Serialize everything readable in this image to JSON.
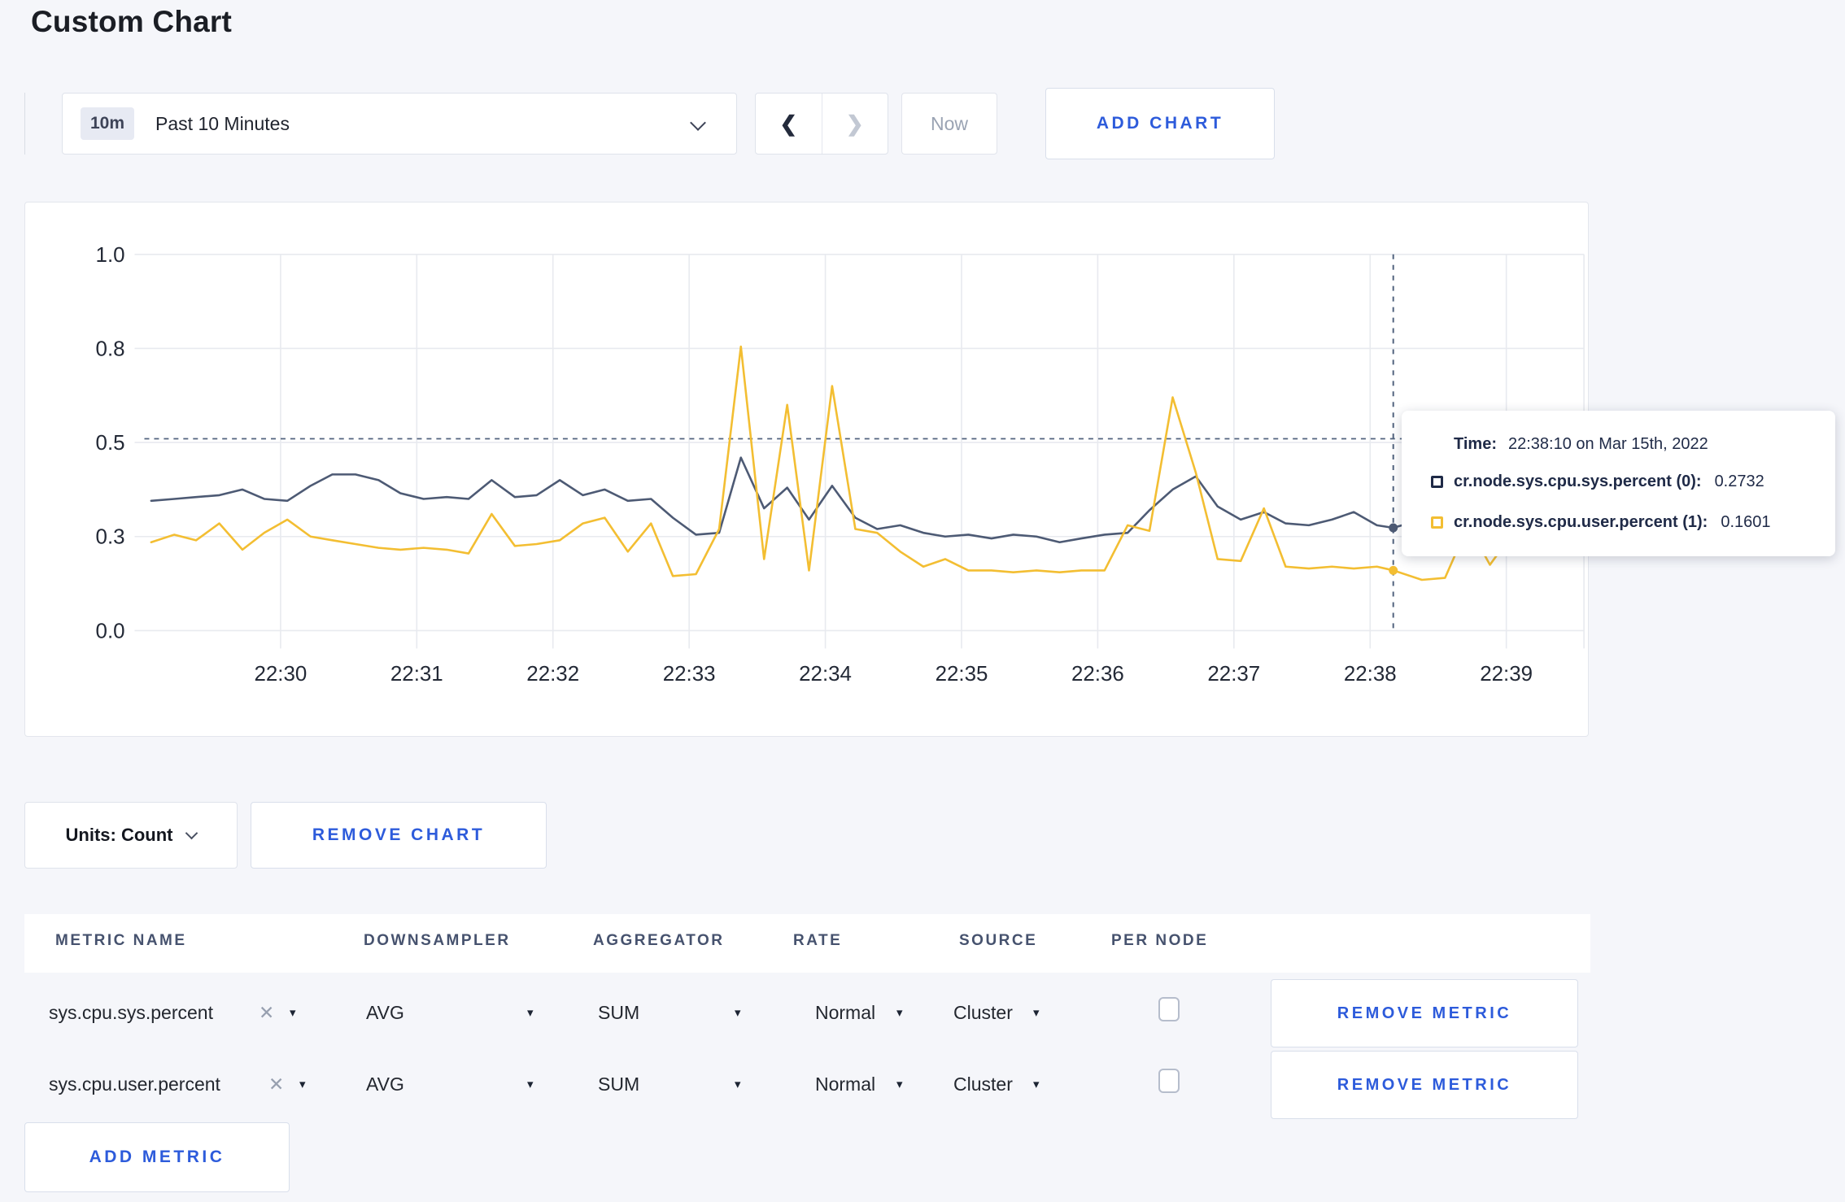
{
  "page": {
    "title": "Custom Chart",
    "background": "#f5f6fa",
    "accent_blue": "#2d5bdb"
  },
  "toolbar": {
    "time_badge": "10m",
    "time_label": "Past 10 Minutes",
    "prev_label": "❮",
    "next_label": "❯",
    "now_label": "Now",
    "add_chart_label": "ADD CHART"
  },
  "chart_data": {
    "type": "line",
    "title": "",
    "xlabel": "",
    "ylabel": "",
    "grid": true,
    "legend_position": "tooltip-only",
    "y_axis": {
      "range": [
        0,
        1
      ],
      "gridline_values": [
        0,
        0.25,
        0.5,
        0.75,
        1.0
      ],
      "tick_labels": [
        "0.0",
        "0.3",
        "0.5",
        "0.8",
        "1.0"
      ]
    },
    "x_axis": {
      "tick_labels": [
        "22:30",
        "22:31",
        "22:32",
        "22:33",
        "22:34",
        "22:35",
        "22:36",
        "22:37",
        "22:38",
        "22:39"
      ],
      "tick_minutes": [
        0,
        1,
        2,
        3,
        4,
        5,
        6,
        7,
        8,
        9
      ],
      "domain_minutes": [
        -1.0,
        9.57
      ],
      "date": "Mar 15th, 2022"
    },
    "x_minutes": [
      -0.95,
      -0.78,
      -0.62,
      -0.45,
      -0.28,
      -0.12,
      0.05,
      0.22,
      0.38,
      0.55,
      0.72,
      0.88,
      1.05,
      1.22,
      1.38,
      1.55,
      1.72,
      1.88,
      2.05,
      2.22,
      2.38,
      2.55,
      2.72,
      2.88,
      3.05,
      3.22,
      3.38,
      3.55,
      3.72,
      3.88,
      4.05,
      4.22,
      4.38,
      4.55,
      4.72,
      4.88,
      5.05,
      5.22,
      5.38,
      5.55,
      5.72,
      5.88,
      6.05,
      6.22,
      6.38,
      6.55,
      6.72,
      6.88,
      7.05,
      7.22,
      7.38,
      7.55,
      7.72,
      7.88,
      8.05,
      8.17,
      8.38,
      8.55,
      8.72,
      8.88,
      9.05
    ],
    "series": [
      {
        "name": "cr.node.sys.cpu.sys.percent (0)",
        "color": "#4d5a74",
        "values": [
          0.345,
          0.35,
          0.355,
          0.36,
          0.375,
          0.35,
          0.345,
          0.385,
          0.415,
          0.415,
          0.4,
          0.365,
          0.35,
          0.355,
          0.35,
          0.4,
          0.355,
          0.36,
          0.4,
          0.36,
          0.375,
          0.345,
          0.35,
          0.3,
          0.255,
          0.26,
          0.46,
          0.325,
          0.38,
          0.295,
          0.385,
          0.3,
          0.27,
          0.28,
          0.26,
          0.25,
          0.255,
          0.245,
          0.255,
          0.25,
          0.235,
          0.245,
          0.255,
          0.26,
          0.32,
          0.375,
          0.41,
          0.33,
          0.295,
          0.315,
          0.285,
          0.28,
          0.295,
          0.315,
          0.28,
          0.2732,
          0.295,
          0.305,
          0.295,
          0.29,
          0.275
        ]
      },
      {
        "name": "cr.node.sys.cpu.user.percent (1)",
        "color": "#f3be32",
        "values": [
          0.235,
          0.255,
          0.24,
          0.285,
          0.215,
          0.26,
          0.295,
          0.25,
          0.24,
          0.23,
          0.22,
          0.215,
          0.22,
          0.215,
          0.205,
          0.31,
          0.225,
          0.23,
          0.24,
          0.285,
          0.3,
          0.21,
          0.285,
          0.145,
          0.15,
          0.27,
          0.755,
          0.19,
          0.6,
          0.16,
          0.65,
          0.27,
          0.26,
          0.21,
          0.17,
          0.19,
          0.16,
          0.16,
          0.155,
          0.16,
          0.155,
          0.16,
          0.16,
          0.28,
          0.265,
          0.62,
          0.42,
          0.19,
          0.185,
          0.325,
          0.17,
          0.165,
          0.17,
          0.165,
          0.17,
          0.1601,
          0.135,
          0.14,
          0.28,
          0.175,
          0.26
        ]
      }
    ],
    "crosshair": {
      "t_minutes": 8.17,
      "time": "22:38:10",
      "y_value": 0.51
    },
    "hover_points": [
      {
        "series": 0,
        "t_minutes": 8.17,
        "value": 0.2732
      },
      {
        "series": 1,
        "t_minutes": 8.17,
        "value": 0.1601
      }
    ]
  },
  "tooltip": {
    "time_label": "Time:",
    "time_value": "22:38:10 on Mar 15th, 2022",
    "rows": [
      {
        "label": "cr.node.sys.cpu.sys.percent (0):",
        "value": "0.2732",
        "color": "#1f2a47"
      },
      {
        "label": "cr.node.sys.cpu.user.percent (1):",
        "value": "0.1601",
        "color": "#f3be32"
      }
    ]
  },
  "chart_footer": {
    "units_label": "Units: Count",
    "remove_chart_label": "REMOVE CHART"
  },
  "metrics_table": {
    "headers": [
      "METRIC NAME",
      "DOWNSAMPLER",
      "AGGREGATOR",
      "RATE",
      "SOURCE",
      "PER NODE"
    ],
    "rows": [
      {
        "metric": "sys.cpu.sys.percent",
        "downsampler": "AVG",
        "aggregator": "SUM",
        "rate": "Normal",
        "source": "Cluster",
        "per_node_checked": false,
        "remove_label": "REMOVE METRIC"
      },
      {
        "metric": "sys.cpu.user.percent",
        "downsampler": "AVG",
        "aggregator": "SUM",
        "rate": "Normal",
        "source": "Cluster",
        "per_node_checked": false,
        "remove_label": "REMOVE METRIC"
      }
    ],
    "add_metric_label": "ADD METRIC",
    "glyphs": {
      "clear": "✕",
      "caret": "▾"
    }
  }
}
